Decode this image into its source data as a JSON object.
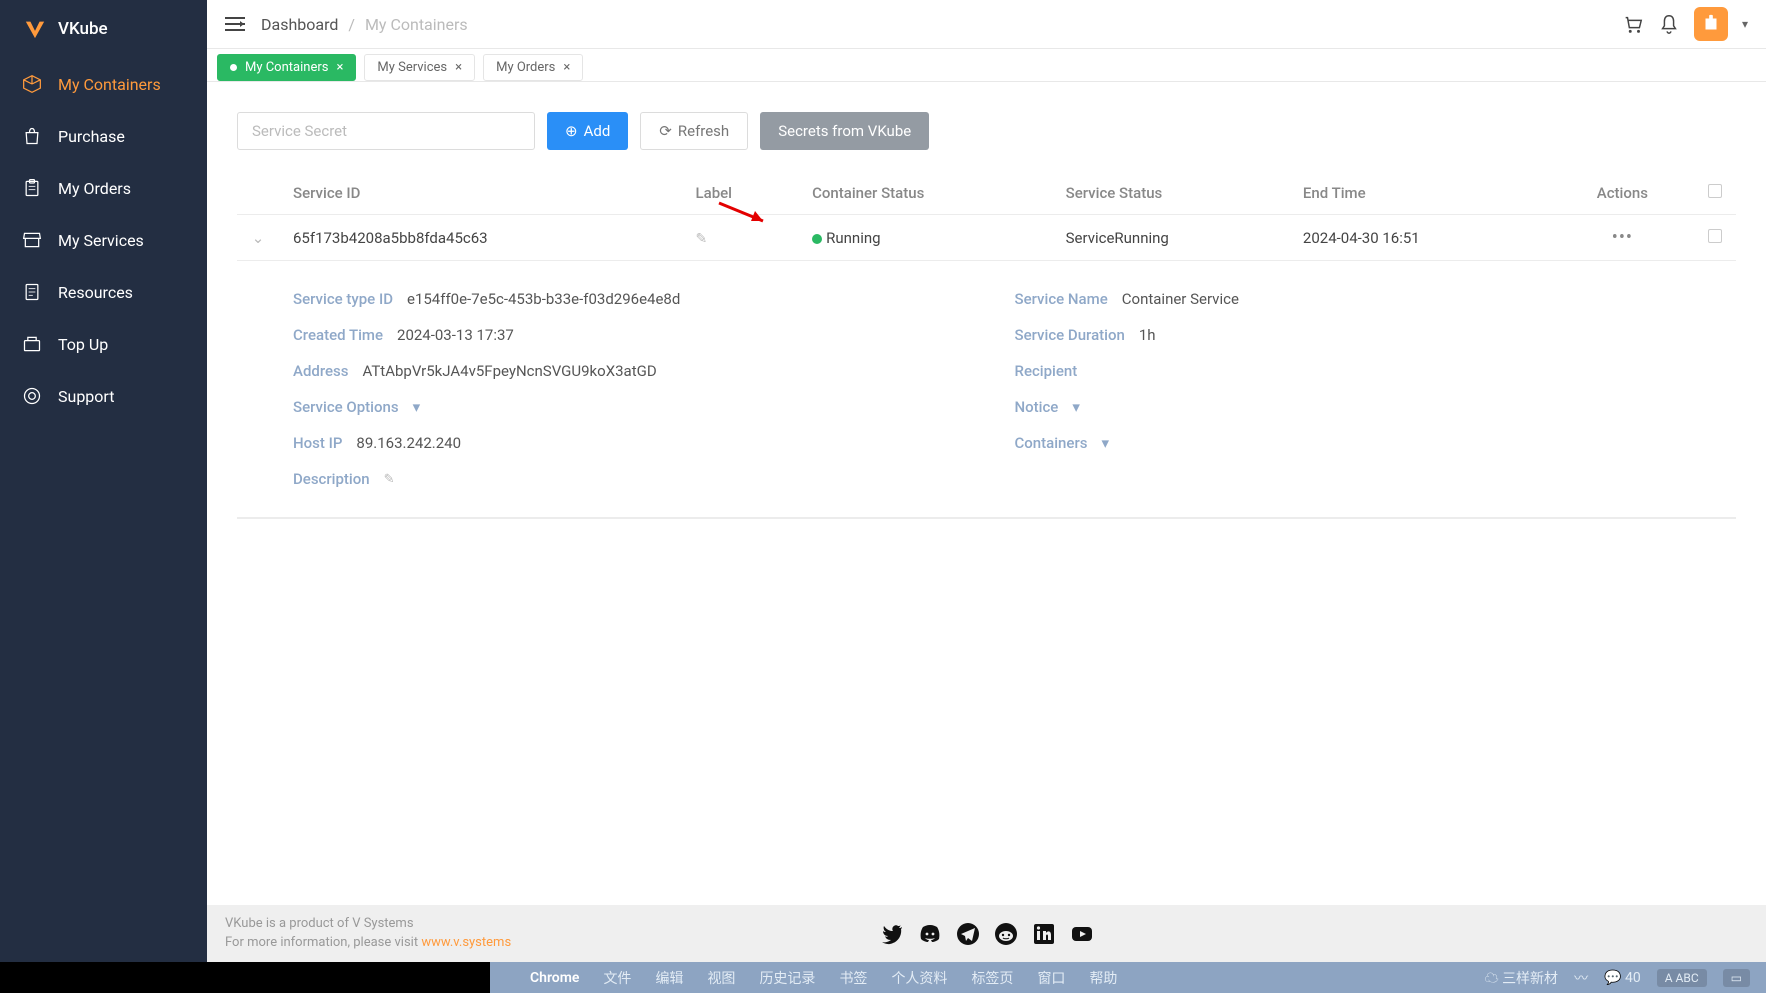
{
  "brand": {
    "name": "VKube"
  },
  "sidebar": {
    "items": [
      {
        "label": "My Containers"
      },
      {
        "label": "Purchase"
      },
      {
        "label": "My Orders"
      },
      {
        "label": "My Services"
      },
      {
        "label": "Resources"
      },
      {
        "label": "Top Up"
      },
      {
        "label": "Support"
      }
    ]
  },
  "breadcrumb": {
    "root": "Dashboard",
    "current": "My Containers"
  },
  "tabs": [
    {
      "label": "My Containers",
      "active": true
    },
    {
      "label": "My Services",
      "active": false
    },
    {
      "label": "My Orders",
      "active": false
    }
  ],
  "toolbar": {
    "search_placeholder": "Service Secret",
    "add_label": "Add",
    "refresh_label": "Refresh",
    "secrets_label": "Secrets from VKube"
  },
  "table": {
    "columns": [
      "Service ID",
      "Label",
      "Container Status",
      "Service Status",
      "End Time",
      "Actions"
    ],
    "rows": [
      {
        "service_id": "65f173b4208a5bb8fda45c63",
        "label": "",
        "container_status": "Running",
        "service_status": "ServiceRunning",
        "end_time": "2024-04-30 16:51"
      }
    ]
  },
  "detail": {
    "left": [
      {
        "label": "Service type ID",
        "value": "e154ff0e-7e5c-453b-b33e-f03d296e4e8d"
      },
      {
        "label": "Created Time",
        "value": "2024-03-13 17:37"
      },
      {
        "label": "Address",
        "value": "ATtAbpVr5kJA4v5FpeyNcnSVGU9koX3atGD"
      },
      {
        "label": "Service Options",
        "expandable": true
      },
      {
        "label": "Host IP",
        "value": "89.163.242.240"
      },
      {
        "label": "Description",
        "editable": true
      }
    ],
    "right": [
      {
        "label": "Service Name",
        "value": "Container Service"
      },
      {
        "label": "Service Duration",
        "value": "1h"
      },
      {
        "label": "Recipient",
        "value": ""
      },
      {
        "label": "Notice",
        "expandable": true
      },
      {
        "label": "Containers",
        "expandable": true
      }
    ]
  },
  "footer": {
    "line1": "VKube is a product of V Systems",
    "line2": "For more information, please visit ",
    "link": "www.v.systems"
  },
  "menubar": {
    "app": "Chrome",
    "items": [
      "文件",
      "编辑",
      "视图",
      "历史记录",
      "书签",
      "个人资料",
      "标签页",
      "窗口",
      "帮助"
    ],
    "right": {
      "status": "三样新材",
      "wechat": "40",
      "input": "ABC"
    }
  }
}
